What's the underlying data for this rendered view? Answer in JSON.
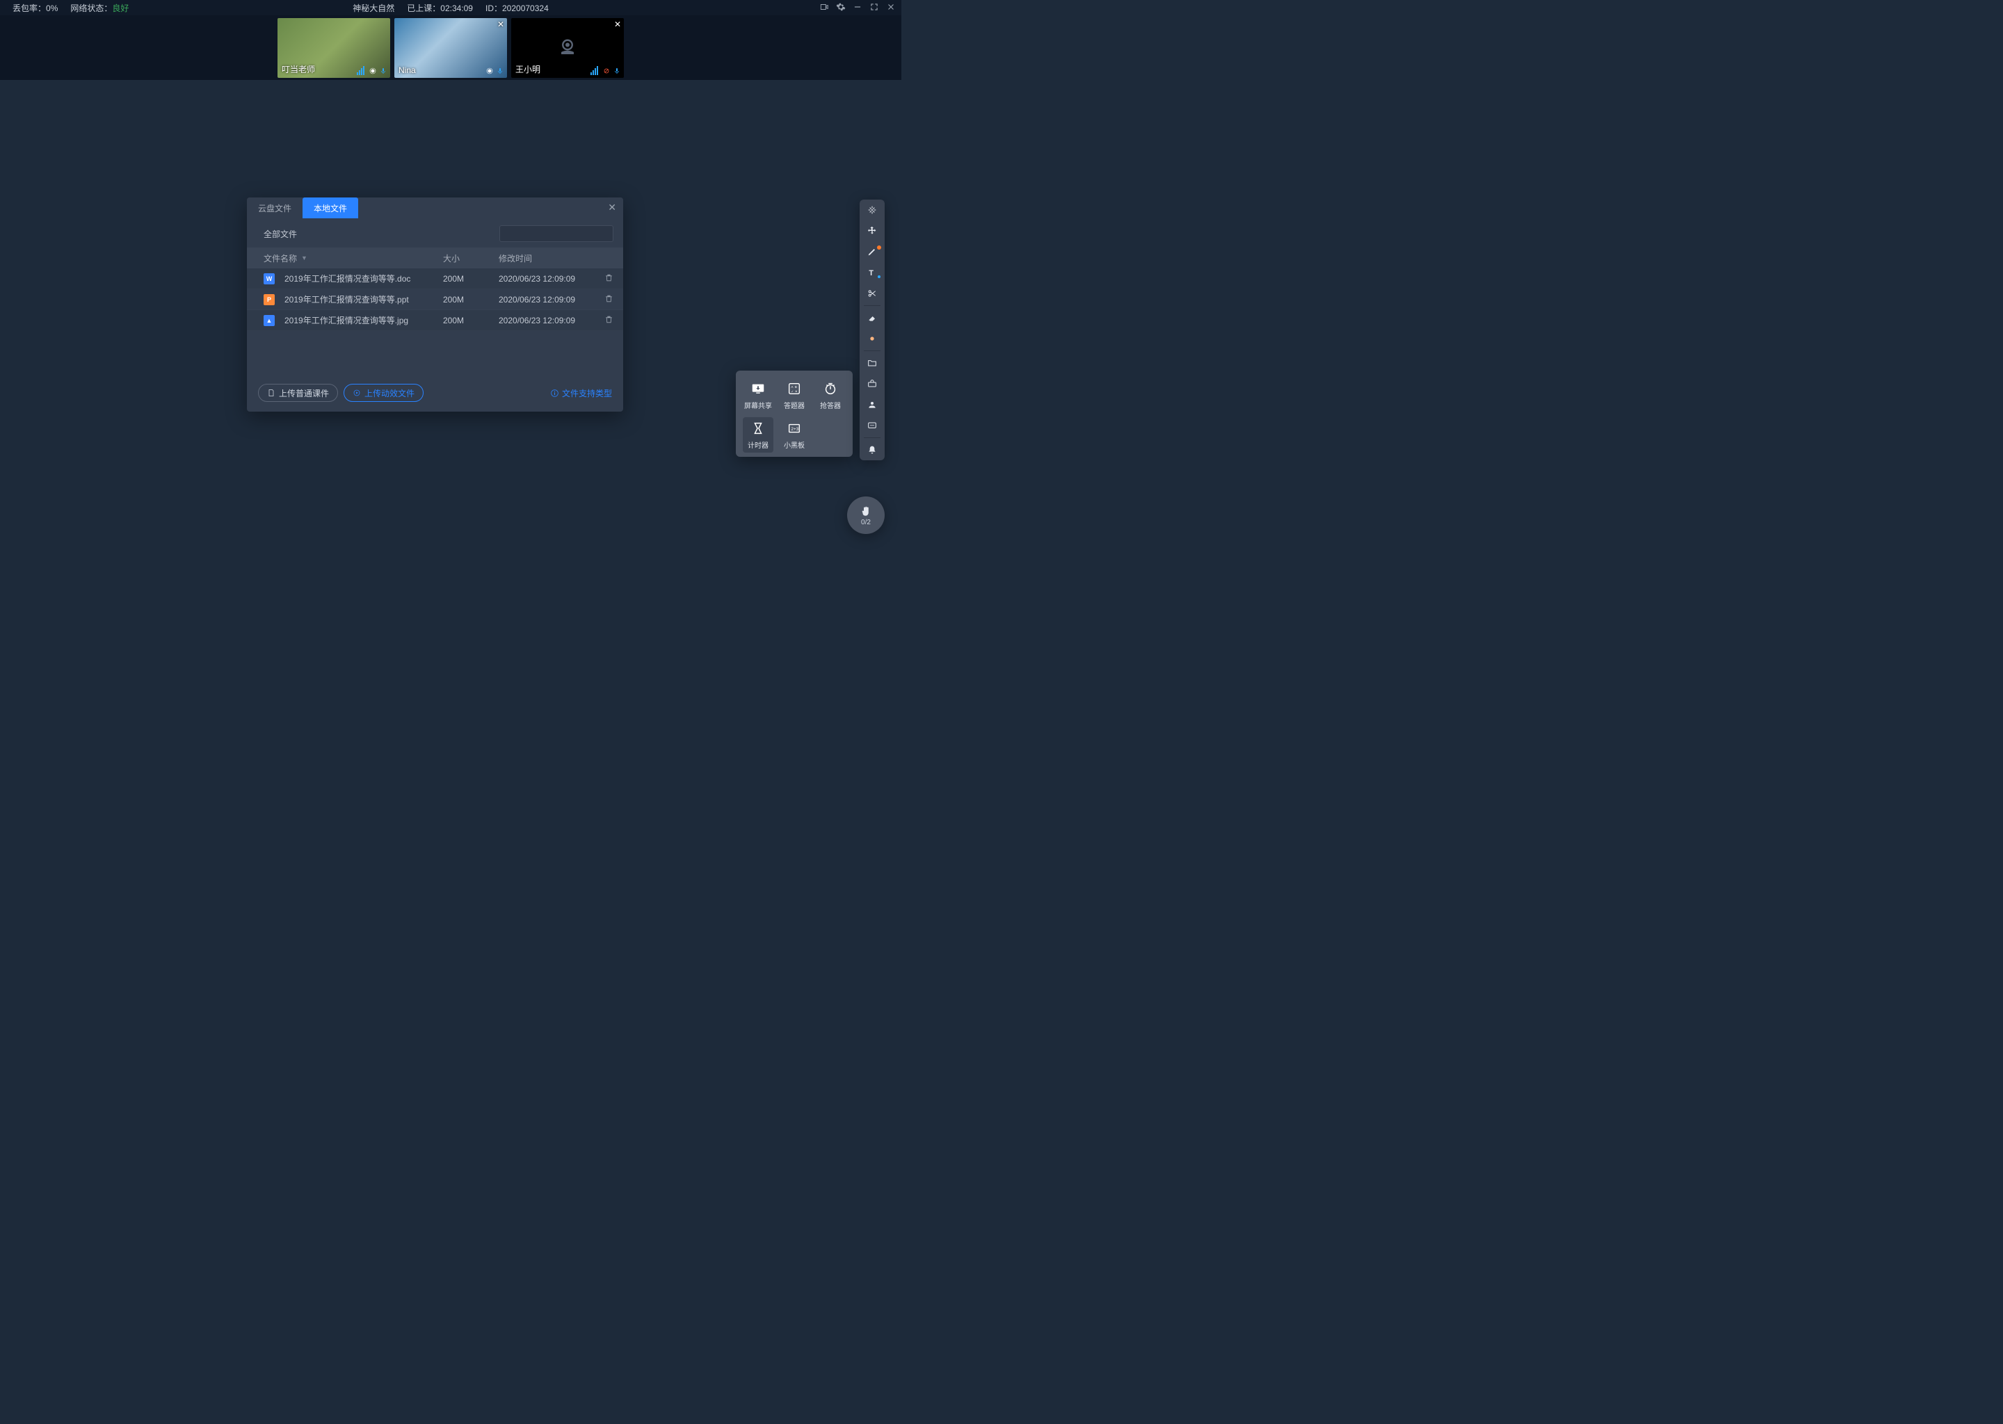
{
  "topbar": {
    "packet_loss_label": "丢包率：",
    "packet_loss_value": "0%",
    "net_label": "网络状态：",
    "net_value": "良好",
    "title": "神秘大自然",
    "elapsed_label": "已上课：",
    "elapsed_value": "02:34:09",
    "id_label": "ID：",
    "id_value": "2020070324"
  },
  "participants": [
    {
      "name": "叮当老师",
      "role": "teacher",
      "closeable": false,
      "cam_on": true,
      "mic_muted": false
    },
    {
      "name": "Nina",
      "role": "student",
      "closeable": true,
      "cam_on": true,
      "mic_muted": false
    },
    {
      "name": "王小明",
      "role": "student",
      "closeable": true,
      "cam_on": false,
      "mic_muted": true
    }
  ],
  "dialog": {
    "tabs": {
      "cloud": "云盘文件",
      "local": "本地文件"
    },
    "active_tab": "local",
    "all_files_label": "全部文件",
    "columns": {
      "name": "文件名称",
      "size": "大小",
      "time": "修改时间"
    },
    "files": [
      {
        "icon": "W",
        "icon_cls": "fi-doc",
        "name": "2019年工作汇报情况查询等等.doc",
        "size": "200M",
        "time": "2020/06/23 12:09:09"
      },
      {
        "icon": "P",
        "icon_cls": "fi-ppt",
        "name": "2019年工作汇报情况查询等等.ppt",
        "size": "200M",
        "time": "2020/06/23 12:09:09"
      },
      {
        "icon": "▲",
        "icon_cls": "fi-jpg",
        "name": "2019年工作汇报情况查询等等.jpg",
        "size": "200M",
        "time": "2020/06/23 12:09:09"
      }
    ],
    "upload_normal": "上传普通课件",
    "upload_anim": "上传动效文件",
    "support_types": "文件支持类型",
    "search_placeholder": ""
  },
  "tools_panel": {
    "screen_share": "屏幕共享",
    "answer": "答题器",
    "responder": "抢答器",
    "timer": "计时器",
    "blackboard": "小黑板"
  },
  "hand_badge": {
    "count": "0/2"
  }
}
